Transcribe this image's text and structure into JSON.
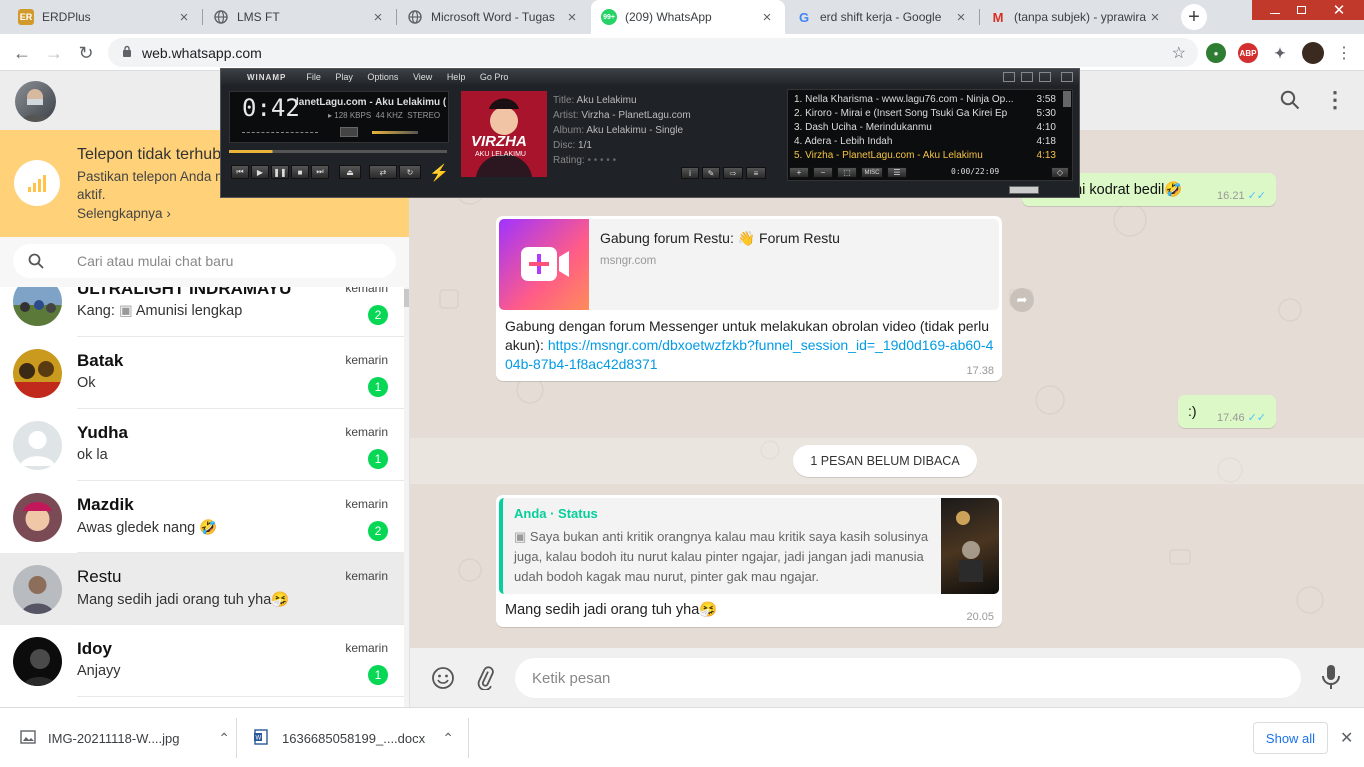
{
  "browser": {
    "tabs": [
      {
        "title": "ERDPlus",
        "favicon": "ER"
      },
      {
        "title": "LMS FT",
        "favicon": "globe"
      },
      {
        "title": "Microsoft Word - Tugas",
        "favicon": "globe"
      },
      {
        "title": "(209) WhatsApp",
        "favicon": "99+"
      },
      {
        "title": "erd shift kerja - Google",
        "favicon": "G"
      },
      {
        "title": "(tanpa subjek) - yprawira",
        "favicon": "M"
      }
    ],
    "active_tab": 3,
    "url": "web.whatsapp.com"
  },
  "notice": {
    "title": "Telepon tidak terhubung",
    "text": "Pastikan telepon Anda memiliki koneksi internet yang aktif.",
    "link": "Selengkapnya ›"
  },
  "search": {
    "placeholder": "Cari atau mulai chat baru"
  },
  "chats": [
    {
      "name": "ULTRALIGHT INDRAMAYU",
      "prefix": "Kang:",
      "message": "Amunisi lengkap",
      "time": "kemarin",
      "unread": "2"
    },
    {
      "name": "Batak",
      "message": "Ok",
      "time": "kemarin",
      "unread": "1"
    },
    {
      "name": "Yudha",
      "message": "ok la",
      "time": "kemarin",
      "unread": "1"
    },
    {
      "name": "Mazdik",
      "message": "Awas gledek nang 🤣",
      "time": "kemarin",
      "unread": "2"
    },
    {
      "name": "Restu",
      "message": "Mang sedih jadi orang tuh yha🤧",
      "time": "kemarin",
      "unread": ""
    },
    {
      "name": "Idoy",
      "message": "Anjayy",
      "time": "kemarin",
      "unread": "1"
    }
  ],
  "messages": {
    "top_out": {
      "text": "ahi kodrat bedil🤣",
      "time": "16.21"
    },
    "link_msg": {
      "card_title": "Gabung forum Restu: 👋 Forum Restu",
      "card_domain": "msngr.com",
      "text": "Gabung dengan forum Messenger untuk melakukan obrolan video (tidak perlu akun):",
      "link": "https://msngr.com/dbxoetwzfzkb?funnel_session_id=_19d0d169-ab60-404b-87b4-1f8ac42d8371",
      "time": "17.38"
    },
    "smile": {
      "text": ":)",
      "time": "17.46"
    },
    "unread_divider": "1 PESAN BELUM DIBACA",
    "reply_msg": {
      "quote_author": "Anda · Status",
      "quote_text": "Saya bukan anti kritik orangnya kalau mau kritik saya kasih solusinya juga, kalau bodoh itu nurut kalau pinter ngajar, jadi jangan jadi manusia udah bodoh kagak mau nurut, pinter gak mau ngajar.",
      "text": "Mang sedih jadi orang tuh yha🤧",
      "time": "20.05"
    }
  },
  "composer": {
    "placeholder": "Ketik pesan"
  },
  "downloads": [
    {
      "name": "IMG-20211118-W....jpg"
    },
    {
      "name": "1636685058199_....docx"
    }
  ],
  "downloads_show_all": "Show all",
  "winamp": {
    "logo": "WINAMP",
    "menu": [
      "File",
      "Play",
      "Options",
      "View",
      "Help",
      "Go Pro"
    ],
    "time": "0:42",
    "scroll_title": "lanetLagu.com - Aku Lelakimu (",
    "kbps": "128",
    "khz": "44",
    "kbps_label": "KBPS",
    "khz_label": "KHZ",
    "stereo": "STEREO",
    "meta_labels": [
      "Title:",
      "Artist:",
      "Album:",
      "Disc:",
      "Rating:"
    ],
    "meta_values": [
      "Aku Lelakimu",
      "Virzha - PlanetLagu.com",
      "Aku Lelakimu - Single",
      "1/1",
      "• • • • •"
    ],
    "playlist": [
      {
        "title": "1. Nella Kharisma - www.lagu76.com - Ninja Op...",
        "dur": "3:58"
      },
      {
        "title": "2. Kiroro - Mirai e (Insert Song Tsuki Ga Kirei Ep",
        "dur": "5:30"
      },
      {
        "title": "3. Dash Uciha - Merindukanmu",
        "dur": "4:10"
      },
      {
        "title": "4. Adera - Lebih Indah",
        "dur": "4:18"
      },
      {
        "title": "5. Virzha - PlanetLagu.com - Aku Lelakimu",
        "dur": "4:13"
      }
    ],
    "playlist_time": "0:00/22:09",
    "misc": "MISC",
    "album_text": "VIRZHA",
    "album_sub": "AKU LELAKIMU"
  }
}
